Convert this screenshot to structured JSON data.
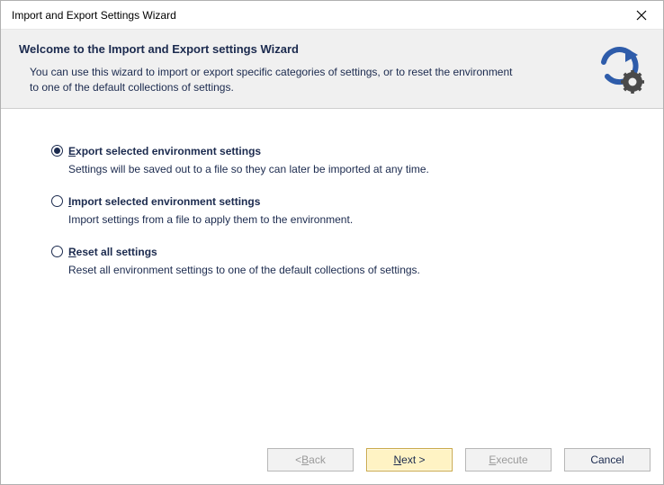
{
  "window": {
    "title": "Import and Export Settings Wizard"
  },
  "header": {
    "title": "Welcome to the Import and Export settings Wizard",
    "description": "You can use this wizard to import or export specific categories of settings, or to reset the environment to one of the default collections of settings."
  },
  "options": [
    {
      "label_pre": "E",
      "label_rest": "xport selected environment settings",
      "description": "Settings will be saved out to a file so they can later be imported at any time.",
      "selected": true
    },
    {
      "label_pre": "I",
      "label_rest": "mport selected environment settings",
      "description": "Import settings from a file to apply them to the environment.",
      "selected": false
    },
    {
      "label_pre": "R",
      "label_rest": "eset all settings",
      "description": "Reset all environment settings to one of the default collections of settings.",
      "selected": false
    }
  ],
  "buttons": {
    "back_pre": "< ",
    "back_u": "B",
    "back_rest": "ack",
    "next_u": "N",
    "next_rest": "ext >",
    "execute_u": "E",
    "execute_rest": "xecute",
    "cancel": "Cancel"
  }
}
